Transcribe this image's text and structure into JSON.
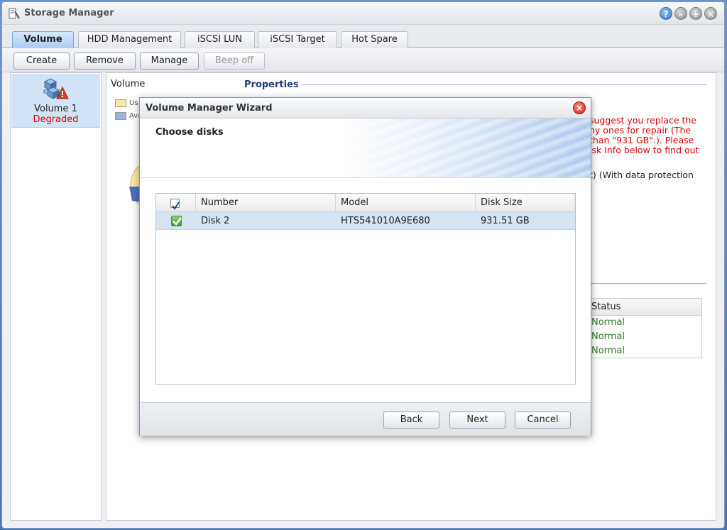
{
  "window": {
    "title": "Storage Manager"
  },
  "tabs": [
    {
      "label": "Volume",
      "active": true
    },
    {
      "label": "HDD Management",
      "active": false
    },
    {
      "label": "iSCSI LUN",
      "active": false
    },
    {
      "label": "iSCSI Target",
      "active": false
    },
    {
      "label": "Hot Spare",
      "active": false
    }
  ],
  "toolbar": {
    "create": "Create",
    "remove": "Remove",
    "manage": "Manage",
    "beep_off": "Beep off"
  },
  "sidebar": {
    "items": [
      {
        "name": "Volume 1",
        "status": "Degraded"
      }
    ]
  },
  "main": {
    "title": "Volume",
    "legend": [
      {
        "label": "Us",
        "color": "#fde9a4"
      },
      {
        "label": "Ava",
        "color": "#9db3e3"
      }
    ],
    "properties_title": "Properties",
    "warning_text": "suggest you replace the\nhy ones for repair (The\nthan \"931 GB\".). Please\nisk Info below to find out",
    "raid_text": "t) (With data protection",
    "disk_table": {
      "header": "Status",
      "rows": [
        "Normal",
        "Normal",
        "Normal"
      ]
    }
  },
  "dialog": {
    "title": "Volume Manager Wizard",
    "heading": "Choose disks",
    "columns": [
      "Number",
      "Model",
      "Disk Size"
    ],
    "rows": [
      {
        "number": "Disk 2",
        "model": "HTS541010A9E680",
        "size": "931.51 GB",
        "checked": true
      }
    ],
    "buttons": {
      "back": "Back",
      "next": "Next",
      "cancel": "Cancel"
    }
  },
  "colors": {
    "accent": "#2f78d0",
    "selected_row": "#d5e3f3",
    "status_ok": "#2a7a1c",
    "status_warn": "#dd0000"
  }
}
